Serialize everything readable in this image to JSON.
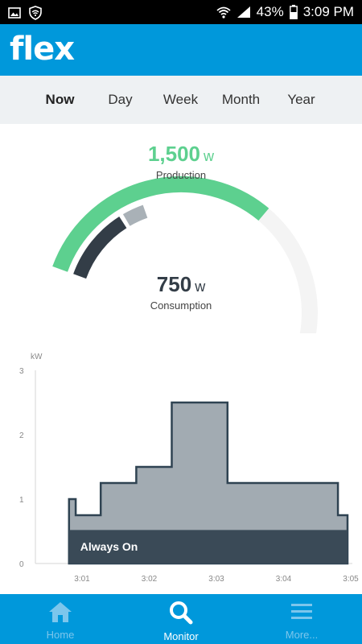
{
  "status_bar": {
    "battery": "43%",
    "time": "3:09 PM",
    "icons": [
      "image-icon",
      "shield-icon",
      "wifi-icon",
      "signal-icon",
      "battery-icon"
    ]
  },
  "app": {
    "logo_text": "flex"
  },
  "tabs": [
    {
      "label": "Now",
      "active": true
    },
    {
      "label": "Day",
      "active": false
    },
    {
      "label": "Week",
      "active": false
    },
    {
      "label": "Month",
      "active": false
    },
    {
      "label": "Year",
      "active": false
    }
  ],
  "production": {
    "value": "1,500",
    "unit": "w",
    "label": "Production"
  },
  "consumption": {
    "value": "750",
    "unit": "w",
    "label": "Consumption"
  },
  "gauge": {
    "production_fraction": 0.5,
    "consumption_fraction": 0.17,
    "always_on_fraction": 0.05,
    "colors": {
      "production": "#5dd08f",
      "consumption": "#333d47",
      "always_on": "#a9b1b7",
      "track": "#f4f4f4"
    }
  },
  "chart_data": {
    "type": "area",
    "ylabel": "kW",
    "ylim": [
      0,
      3
    ],
    "y_ticks": [
      "0",
      "1",
      "2",
      "3"
    ],
    "x_ticks": [
      "3:01",
      "3:02",
      "3:03",
      "3:04",
      "3:05"
    ],
    "xlim": [
      3.0,
      6.3
    ],
    "series": [
      {
        "name": "Consumption",
        "color": "#a2abb2",
        "stroke": "#2f4352",
        "points": [
          [
            3.35,
            0
          ],
          [
            3.35,
            1.0
          ],
          [
            3.42,
            1.0
          ],
          [
            3.42,
            0.75
          ],
          [
            3.68,
            0.75
          ],
          [
            3.68,
            1.25
          ],
          [
            4.05,
            1.25
          ],
          [
            4.05,
            1.5
          ],
          [
            4.42,
            1.5
          ],
          [
            4.42,
            2.5
          ],
          [
            5.0,
            2.5
          ],
          [
            5.0,
            1.25
          ],
          [
            6.15,
            1.25
          ],
          [
            6.15,
            0.75
          ],
          [
            6.25,
            0.75
          ],
          [
            6.25,
            0
          ]
        ]
      },
      {
        "name": "Always On",
        "color": "#3a4a57",
        "points": [
          [
            3.35,
            0
          ],
          [
            3.35,
            0.52
          ],
          [
            6.25,
            0.52
          ],
          [
            6.25,
            0
          ]
        ]
      }
    ],
    "annotation": "Always On"
  },
  "bottom_nav": [
    {
      "label": "Home",
      "icon": "home-icon",
      "active": false
    },
    {
      "label": "Monitor",
      "icon": "search-icon",
      "active": true
    },
    {
      "label": "More...",
      "icon": "menu-icon",
      "active": false
    }
  ]
}
